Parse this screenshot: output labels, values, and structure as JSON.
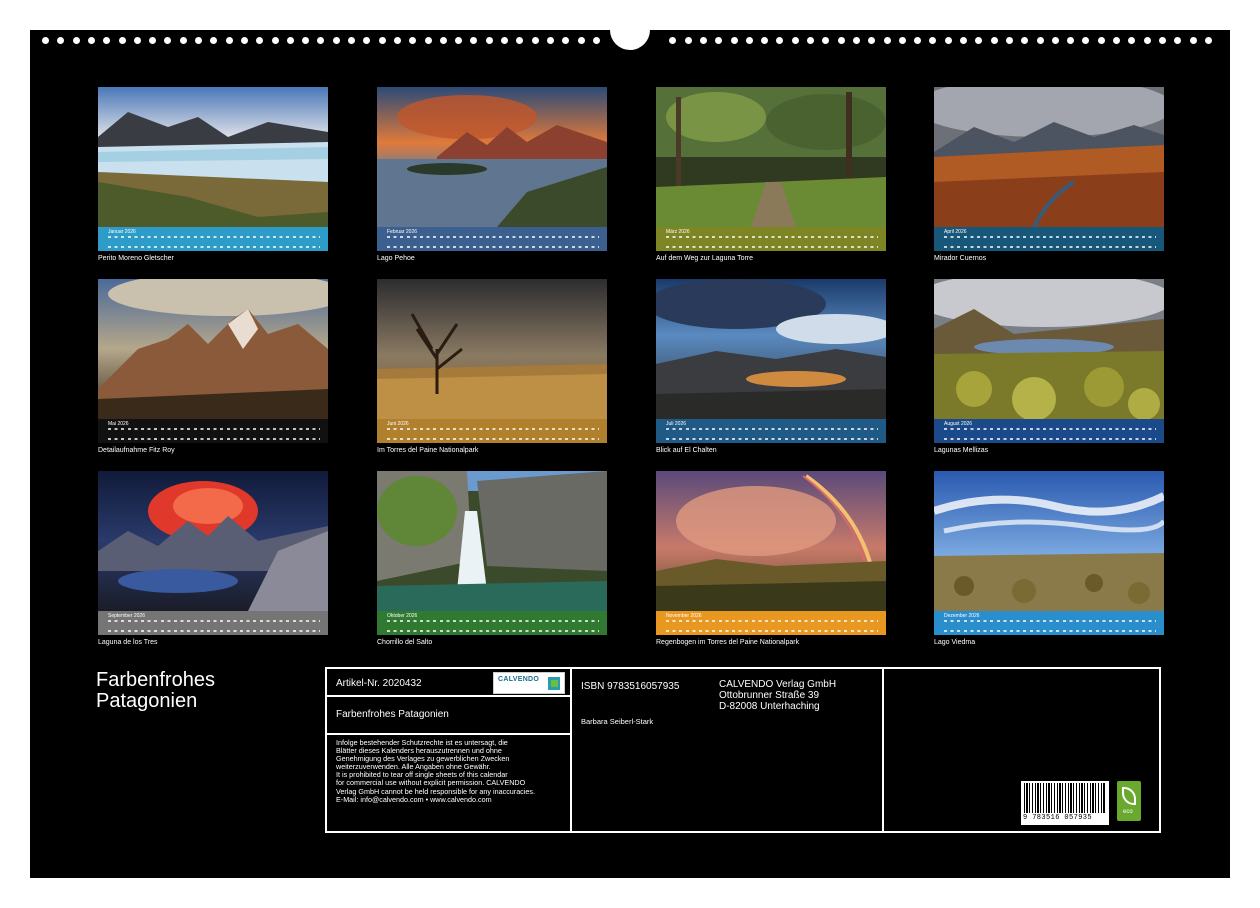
{
  "calendar": {
    "title": "Farbenfrohes Patagonien",
    "title_line1": "Farbenfrohes",
    "title_line2": "Patagonien"
  },
  "months": [
    {
      "label": "Januar 2026",
      "caption": "Perito Moreno Gletscher",
      "bar_color": "#2e9cc8"
    },
    {
      "label": "Februar 2026",
      "caption": "Lago Pehoe",
      "bar_color": "#3b5f8e"
    },
    {
      "label": "März 2026",
      "caption": "Auf dem Weg zur Laguna Torre",
      "bar_color": "#7d8524"
    },
    {
      "label": "April 2026",
      "caption": "Mirador Cuernos",
      "bar_color": "#17577a"
    },
    {
      "label": "Mai 2026",
      "caption": "Detailaufnahme Fitz Roy",
      "bar_color": "#111111"
    },
    {
      "label": "Juni 2026",
      "caption": "Im Torres del Paine Nationalpark",
      "bar_color": "#b0802c"
    },
    {
      "label": "Juli 2026",
      "caption": "Blick auf El Chalten",
      "bar_color": "#1f5a86"
    },
    {
      "label": "August 2026",
      "caption": "Lagunas Mellizas",
      "bar_color": "#1a4a8a"
    },
    {
      "label": "September 2026",
      "caption": "Laguna de los Tres",
      "bar_color": "#757575"
    },
    {
      "label": "Oktober 2026",
      "caption": "Chorrillo del Salto",
      "bar_color": "#2f7a30"
    },
    {
      "label": "November 2026",
      "caption": "Regenbogen im Torres del Paine Nationalpark",
      "bar_color": "#e89820"
    },
    {
      "label": "Dezember 2026",
      "caption": "Lago Viedma",
      "bar_color": "#2a8dcc"
    }
  ],
  "info": {
    "article": "Artikel-Nr. 2020432",
    "product_title": "Farbenfrohes Patagonien",
    "isbn": "ISBN 9783516057935",
    "author": "Barbara Seiberl-Stark",
    "publisher_name": "CALVENDO Verlag GmbH",
    "publisher_street": "Ottobrunner Straße 39",
    "publisher_city": "D-82008 Unterhaching",
    "legal_text": "Infolge bestehender Schutzrechte ist es untersagt, die\nBlätter dieses Kalenders herauszutrennen und ohne\nGenehmigung des Verlages zu gewerblichen Zwecken\nweiterzuverwenden. Alle Angaben ohne Gewähr.\nIt is prohibited to tear off single sheets of this calendar\nfor commercial use without explicit permission. CALVENDO\nVerlag GmbH cannot be held responsible for any inaccuracies.\nE-Mail: info@calvendo.com • www.calvendo.com",
    "logo_text": "CALVENDO",
    "barcode_digits": "9 783516 057935",
    "eco_label": "eco"
  }
}
